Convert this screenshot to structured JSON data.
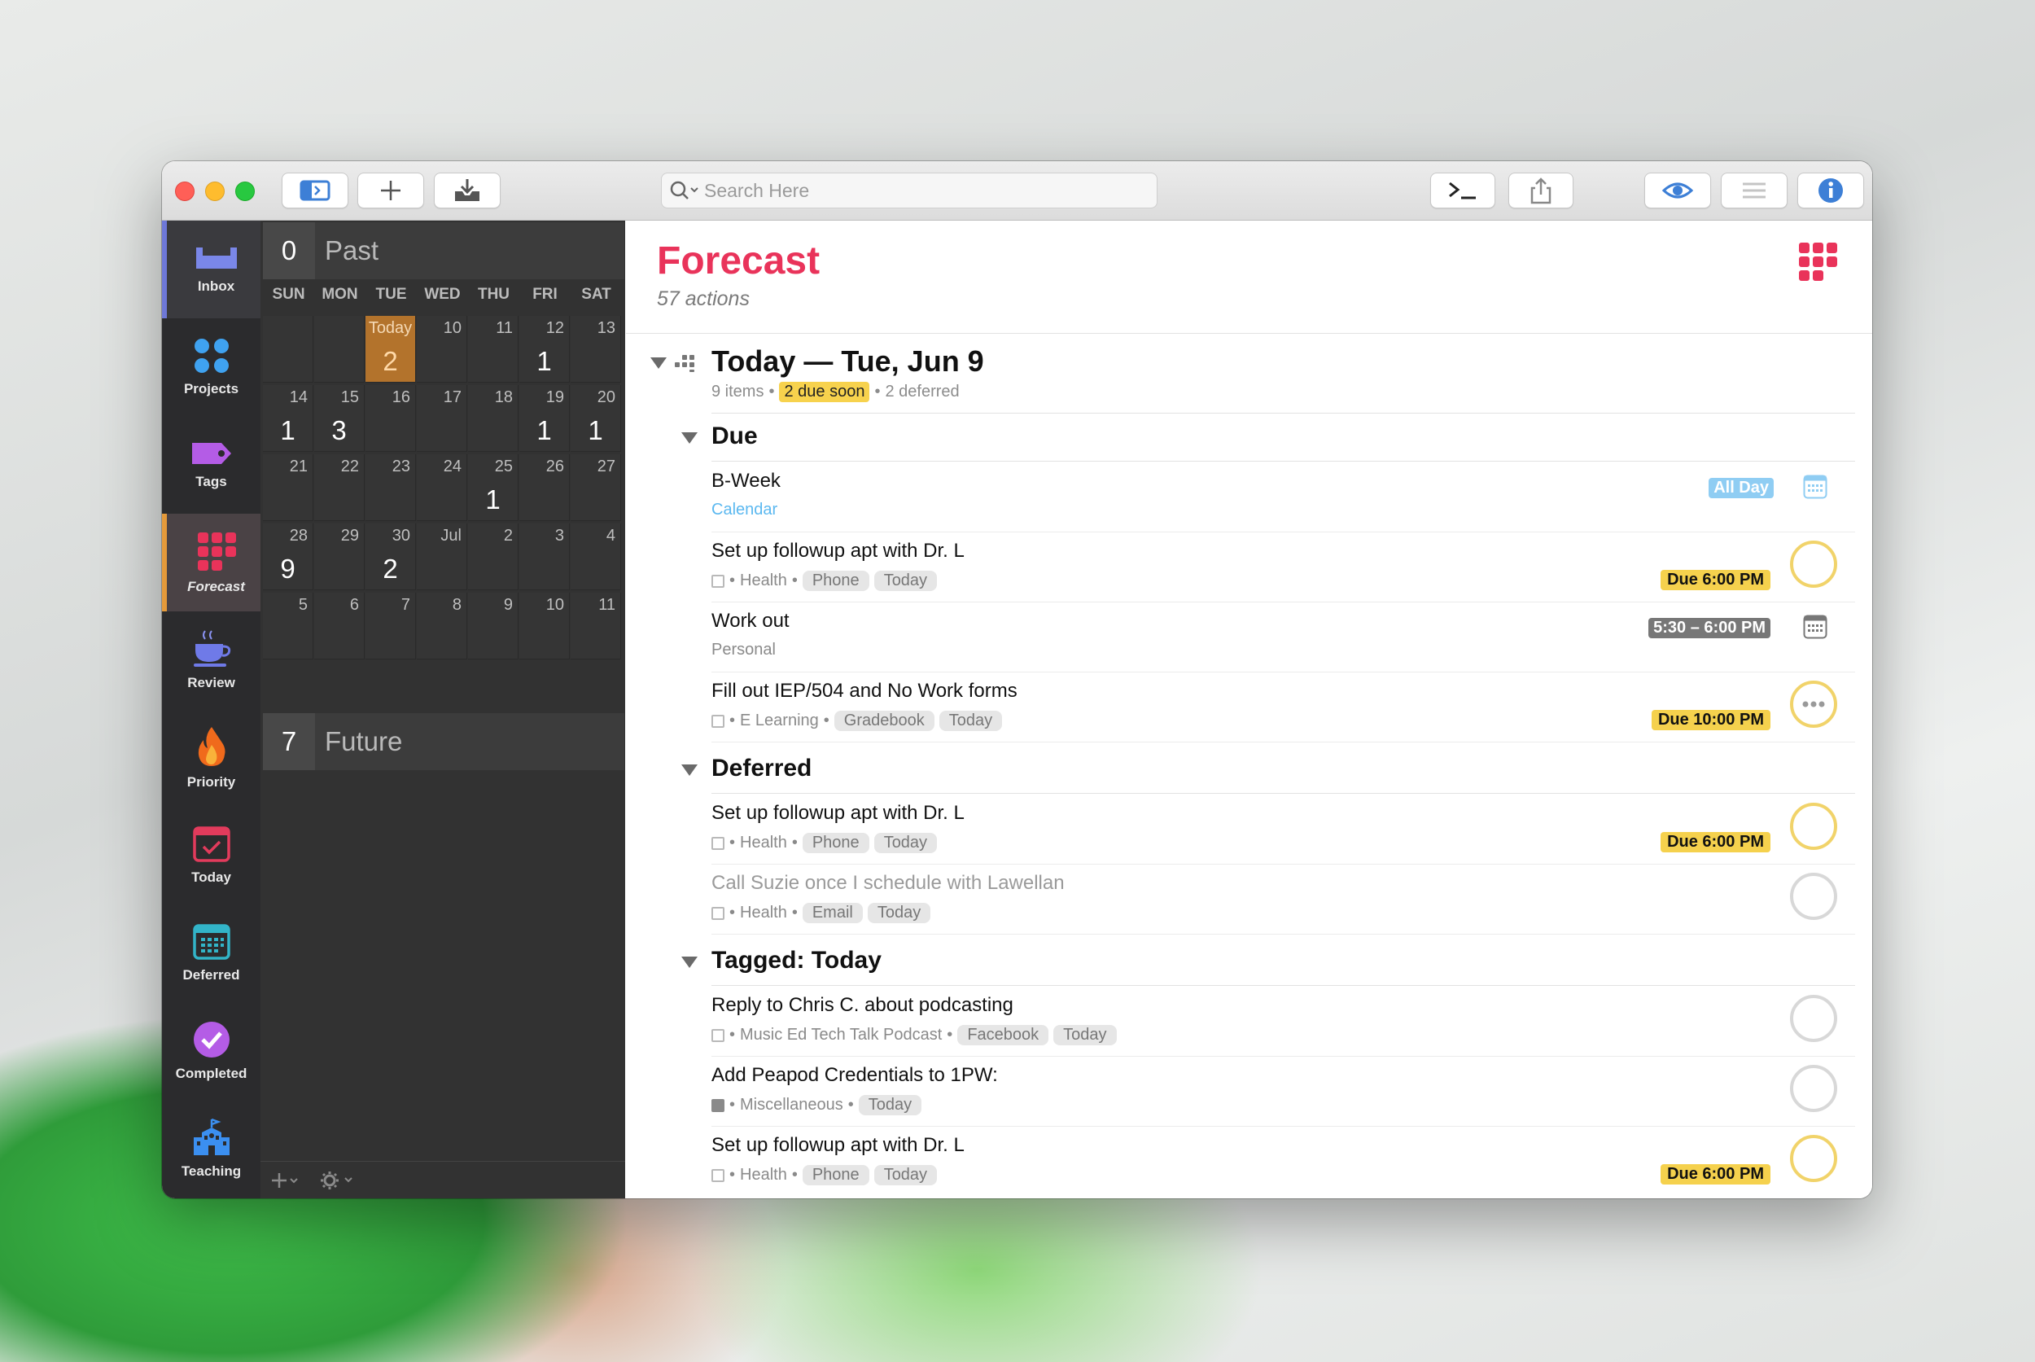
{
  "toolbar": {
    "search_placeholder": "Search Here"
  },
  "sidebar": {
    "items": [
      {
        "label": "Inbox"
      },
      {
        "label": "Projects"
      },
      {
        "label": "Tags"
      },
      {
        "label": "Forecast"
      },
      {
        "label": "Review"
      },
      {
        "label": "Priority"
      },
      {
        "label": "Today"
      },
      {
        "label": "Deferred"
      },
      {
        "label": "Completed"
      },
      {
        "label": "Teaching"
      }
    ]
  },
  "calendar": {
    "past": {
      "count": "0",
      "label": "Past"
    },
    "future": {
      "count": "7",
      "label": "Future"
    },
    "days_of_week": [
      "SUN",
      "MON",
      "TUE",
      "WED",
      "THU",
      "FRI",
      "SAT"
    ],
    "weeks": [
      [
        {
          "d": "",
          "c": ""
        },
        {
          "d": "",
          "c": ""
        },
        {
          "d": "Today",
          "c": "2"
        },
        {
          "d": "10",
          "c": ""
        },
        {
          "d": "11",
          "c": ""
        },
        {
          "d": "12",
          "c": "1"
        },
        {
          "d": "13",
          "c": ""
        }
      ],
      [
        {
          "d": "14",
          "c": "1"
        },
        {
          "d": "15",
          "c": "3"
        },
        {
          "d": "16",
          "c": ""
        },
        {
          "d": "17",
          "c": ""
        },
        {
          "d": "18",
          "c": ""
        },
        {
          "d": "19",
          "c": "1"
        },
        {
          "d": "20",
          "c": "1"
        }
      ],
      [
        {
          "d": "21",
          "c": ""
        },
        {
          "d": "22",
          "c": ""
        },
        {
          "d": "23",
          "c": ""
        },
        {
          "d": "24",
          "c": ""
        },
        {
          "d": "25",
          "c": "1"
        },
        {
          "d": "26",
          "c": ""
        },
        {
          "d": "27",
          "c": ""
        }
      ],
      [
        {
          "d": "28",
          "c": "9"
        },
        {
          "d": "29",
          "c": ""
        },
        {
          "d": "30",
          "c": "2"
        },
        {
          "d": "Jul",
          "c": ""
        },
        {
          "d": "2",
          "c": ""
        },
        {
          "d": "3",
          "c": ""
        },
        {
          "d": "4",
          "c": ""
        }
      ],
      [
        {
          "d": "5",
          "c": ""
        },
        {
          "d": "6",
          "c": ""
        },
        {
          "d": "7",
          "c": ""
        },
        {
          "d": "8",
          "c": ""
        },
        {
          "d": "9",
          "c": ""
        },
        {
          "d": "10",
          "c": ""
        },
        {
          "d": "11",
          "c": ""
        }
      ]
    ]
  },
  "main": {
    "title": "Forecast",
    "subtitle": "57 actions",
    "day": {
      "heading": "Today — Tue, Jun 9",
      "items": "9 items",
      "due_soon": "2 due soon",
      "deferred": "2 deferred"
    },
    "groups": {
      "due": "Due",
      "deferred": "Deferred",
      "tagged": "Tagged: Today"
    },
    "rows": [
      {
        "title": "B-Week",
        "meta": "Calendar",
        "badge": "All Day"
      },
      {
        "title": "Set up followup apt with Dr. L",
        "project": "Health",
        "tags": [
          "Phone",
          "Today"
        ],
        "due": "Due 6:00 PM"
      },
      {
        "title": "Work out",
        "meta": "Personal",
        "badge": "5:30 – 6:00 PM"
      },
      {
        "title": "Fill out IEP/504 and No Work forms",
        "project": "E Learning",
        "tags": [
          "Gradebook",
          "Today"
        ],
        "due": "Due 10:00 PM"
      },
      {
        "title": "Set up followup apt with Dr. L",
        "project": "Health",
        "tags": [
          "Phone",
          "Today"
        ],
        "due": "Due 6:00 PM"
      },
      {
        "title": "Call Suzie once I schedule with Lawellan",
        "project": "Health",
        "tags": [
          "Email",
          "Today"
        ]
      },
      {
        "title": "Reply to Chris C. about podcasting",
        "project": "Music Ed Tech Talk Podcast",
        "tags": [
          "Facebook",
          "Today"
        ]
      },
      {
        "title": "Add Peapod Credentials to 1PW:",
        "project": "Miscellaneous",
        "tags": [
          "Today"
        ]
      },
      {
        "title": "Set up followup apt with Dr. L",
        "project": "Health",
        "tags": [
          "Phone",
          "Today"
        ],
        "due": "Due 6:00 PM"
      }
    ]
  },
  "colors": {
    "accent_forecast": "#e9335a",
    "due_badge": "#f5d14d",
    "calendar_blue": "#5bb8f0",
    "today_cell": "#b3732c"
  }
}
